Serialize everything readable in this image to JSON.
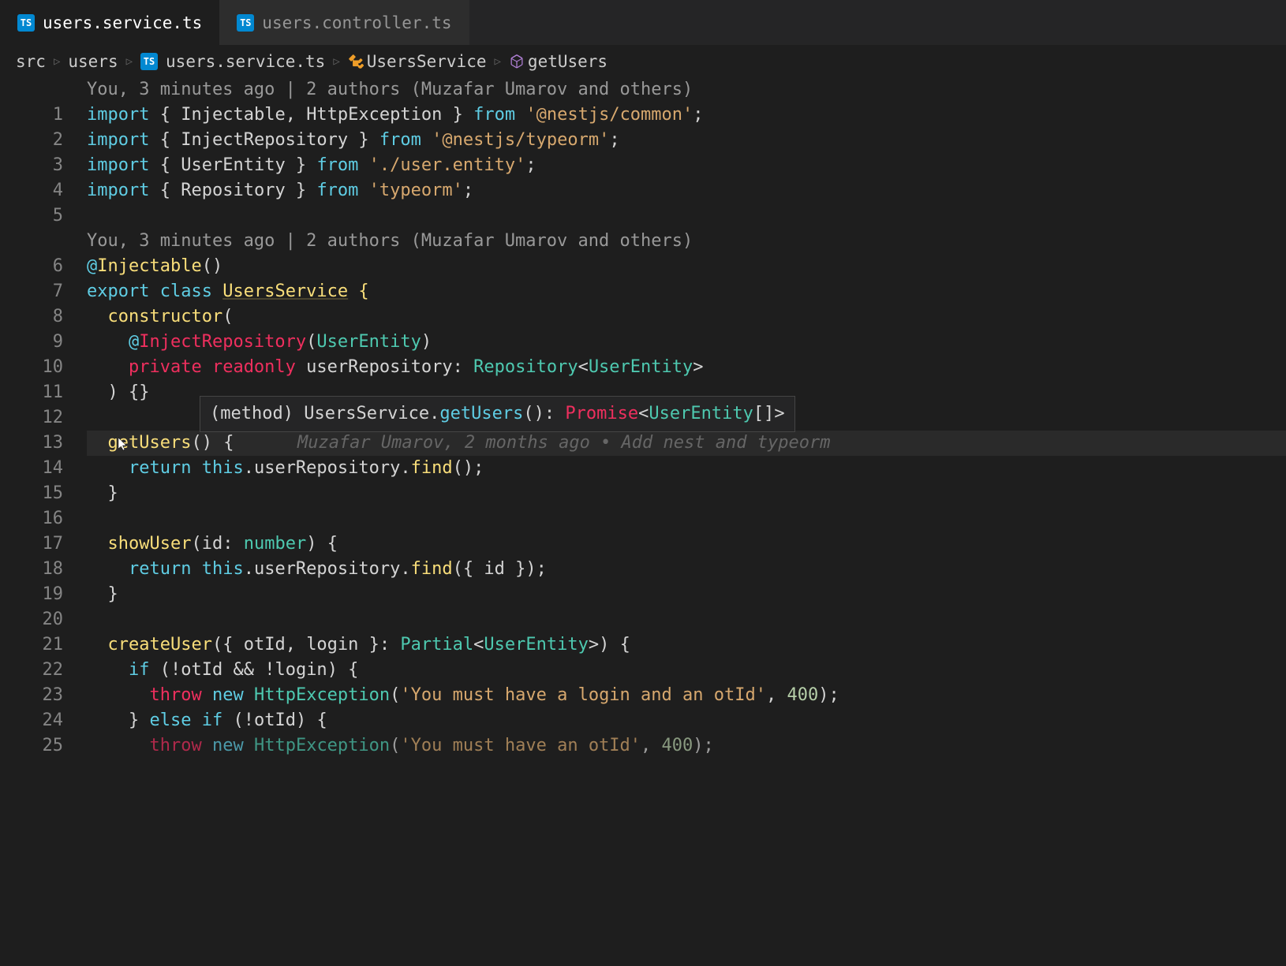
{
  "tabs": [
    {
      "label": "users.service.ts",
      "icon": "TS",
      "active": true
    },
    {
      "label": "users.controller.ts",
      "icon": "TS",
      "active": false
    }
  ],
  "breadcrumbs": {
    "path1": "src",
    "path2": "users",
    "file_icon": "TS",
    "file": "users.service.ts",
    "class": "UsersService",
    "method": "getUsers"
  },
  "codelens1": "You, 3 minutes ago | 2 authors (Muzafar Umarov and others)",
  "codelens2": "You, 3 minutes ago | 2 authors (Muzafar Umarov and others)",
  "lines": {
    "l1": {
      "tokens": [
        "import",
        " { ",
        "Injectable",
        ", ",
        "HttpException",
        " } ",
        "from",
        " ",
        "'@nestjs/common'",
        ";"
      ]
    },
    "l2": {
      "tokens": [
        "import",
        " { ",
        "InjectRepository",
        " } ",
        "from",
        " ",
        "'@nestjs/typeorm'",
        ";"
      ]
    },
    "l3": {
      "tokens": [
        "import",
        " { ",
        "UserEntity",
        " } ",
        "from",
        " ",
        "'./user.entity'",
        ";"
      ]
    },
    "l4": {
      "tokens": [
        "import",
        " { ",
        "Repository",
        " } ",
        "from",
        " ",
        "'typeorm'",
        ";"
      ]
    },
    "l6": {
      "at": "@",
      "decorator": "Injectable",
      "parens": "()"
    },
    "l7": {
      "export": "export",
      "class_kw": "class",
      "class_name": "UsersService",
      "brace": " {"
    },
    "l8": {
      "indent": "  ",
      "func": "constructor",
      "paren": "("
    },
    "l9": {
      "indent": "    ",
      "at": "@",
      "decorator": "InjectRepository",
      "lparen": "(",
      "type": "UserEntity",
      "rparen": ")"
    },
    "l10": {
      "indent": "    ",
      "private": "private",
      "readonly": "readonly",
      "name": "userRepository",
      "colon": ": ",
      "type": "Repository",
      "lt": "<",
      "generic": "UserEntity",
      "gt": ">"
    },
    "l11": {
      "indent": "  ",
      "rparen": ")",
      "braces": " {}"
    },
    "l13": {
      "indent": "  ",
      "method": "getUsers",
      "parens": "()",
      "brace": " {",
      "blame": "Muzafar Umarov, 2 months ago • Add nest and typeorm"
    },
    "l14": {
      "indent": "    ",
      "return": "return",
      "this": "this",
      "dot1": ".",
      "repo": "userRepository",
      "dot2": ".",
      "find": "find",
      "parens": "()",
      "semi": ";"
    },
    "l15": {
      "indent": "  ",
      "brace": "}"
    },
    "l17": {
      "indent": "  ",
      "method": "showUser",
      "lparen": "(",
      "param": "id",
      "colon": ": ",
      "type": "number",
      "rparen": ")",
      "brace": " {"
    },
    "l18": {
      "indent": "    ",
      "return": "return",
      "this": "this",
      "dot1": ".",
      "repo": "userRepository",
      "dot2": ".",
      "find": "find",
      "lparen": "(",
      "obj": "{ ",
      "id": "id",
      "obj2": " }",
      "rparen": ")",
      "semi": ";"
    },
    "l19": {
      "indent": "  ",
      "brace": "}"
    },
    "l21": {
      "indent": "  ",
      "method": "createUser",
      "lparen": "(",
      "lbrace": "{ ",
      "p1": "otId",
      "comma": ", ",
      "p2": "login",
      "rbrace": " }",
      "colon": ": ",
      "type": "Partial",
      "lt": "<",
      "generic": "UserEntity",
      "gt": ">",
      "rparen": ")",
      "brace": " {"
    },
    "l22": {
      "indent": "    ",
      "if": "if",
      "lparen": " (",
      "not1": "!",
      "v1": "otId",
      "and": " && ",
      "not2": "!",
      "v2": "login",
      "rparen": ")",
      "brace": " {"
    },
    "l23": {
      "indent": "      ",
      "throw": "throw",
      "new": "new",
      "exc": "HttpException",
      "lparen": "(",
      "msg": "'You must have a login and an otId'",
      "comma": ", ",
      "code": "400",
      "rparen": ")",
      "semi": ";"
    },
    "l24": {
      "indent": "    ",
      "rbrace": "}",
      "else": " else ",
      "if": "if",
      "lparen": " (",
      "not": "!",
      "v": "otId",
      "rparen": ")",
      "brace": " {"
    },
    "l25": {
      "indent": "      ",
      "throw": "throw",
      "new": "new",
      "exc": "HttpException",
      "lparen": "(",
      "msg": "'You must have an otId'",
      "comma": ", ",
      "code": "400",
      "rparen": ")",
      "semi": ";"
    }
  },
  "tooltip": {
    "method_kw": "(method)",
    "class": "UsersService",
    "dot": ".",
    "method": "getUsers",
    "parens": "()",
    "colon": ": ",
    "promise": "Promise",
    "lt": "<",
    "type": "UserEntity",
    "arr": "[]",
    "gt": ">"
  },
  "gutter_start": 1,
  "gutter_end": 25
}
